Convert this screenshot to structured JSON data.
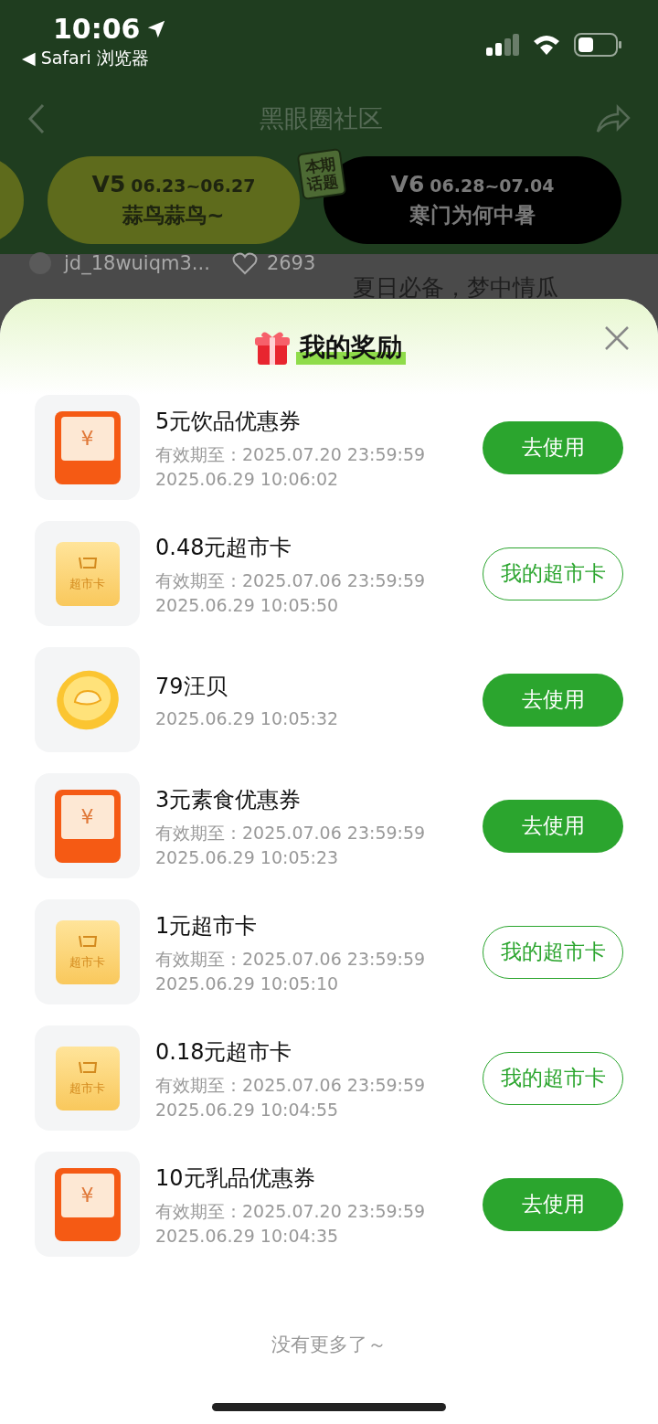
{
  "status_bar": {
    "time": "10:06",
    "back_app": "◀ Safari 浏览器"
  },
  "nav": {
    "title": "黑眼圈社区"
  },
  "topics": [
    {
      "selected": false
    },
    {
      "version": "V5",
      "dates": "06.23~06.27",
      "name": "蒜鸟蒜鸟~",
      "selected": false
    },
    {
      "version": "V6",
      "dates": "06.28~07.04",
      "name": "寒门为何中暑",
      "selected": true,
      "tag": "本期话题"
    }
  ],
  "feed_peek": {
    "user": "jd_18wuiqm3...",
    "likes": "2693",
    "post_title": "夏日必备，梦中情瓜"
  },
  "sheet": {
    "title": "我的奖励",
    "rewards": [
      {
        "kind": "coupon",
        "icon_text": "¥",
        "title": "5元饮品优惠券",
        "expiry": "有效期至：2025.07.20 23:59:59",
        "time": "2025.06.29 10:06:02",
        "button": {
          "label": "去使用",
          "kind": "filled"
        }
      },
      {
        "kind": "card",
        "icon_text": "超市卡",
        "title": "0.48元超市卡",
        "expiry": "有效期至：2025.07.06 23:59:59",
        "time": "2025.06.29 10:05:50",
        "button": {
          "label": "我的超市卡",
          "kind": "outline"
        }
      },
      {
        "kind": "coin",
        "title": "79汪贝",
        "time": "2025.06.29 10:05:32",
        "button": {
          "label": "去使用",
          "kind": "filled"
        }
      },
      {
        "kind": "coupon",
        "icon_text": "¥",
        "title": "3元素食优惠券",
        "expiry": "有效期至：2025.07.06 23:59:59",
        "time": "2025.06.29 10:05:23",
        "button": {
          "label": "去使用",
          "kind": "filled"
        }
      },
      {
        "kind": "card",
        "icon_text": "超市卡",
        "title": "1元超市卡",
        "expiry": "有效期至：2025.07.06 23:59:59",
        "time": "2025.06.29 10:05:10",
        "button": {
          "label": "我的超市卡",
          "kind": "outline"
        }
      },
      {
        "kind": "card",
        "icon_text": "超市卡",
        "title": "0.18元超市卡",
        "expiry": "有效期至：2025.07.06 23:59:59",
        "time": "2025.06.29 10:04:55",
        "button": {
          "label": "我的超市卡",
          "kind": "outline"
        }
      },
      {
        "kind": "coupon",
        "icon_text": "¥",
        "title": "10元乳品优惠券",
        "expiry": "有效期至：2025.07.20 23:59:59",
        "time": "2025.06.29 10:04:35",
        "button": {
          "label": "去使用",
          "kind": "filled"
        }
      }
    ],
    "footer": "没有更多了～"
  }
}
